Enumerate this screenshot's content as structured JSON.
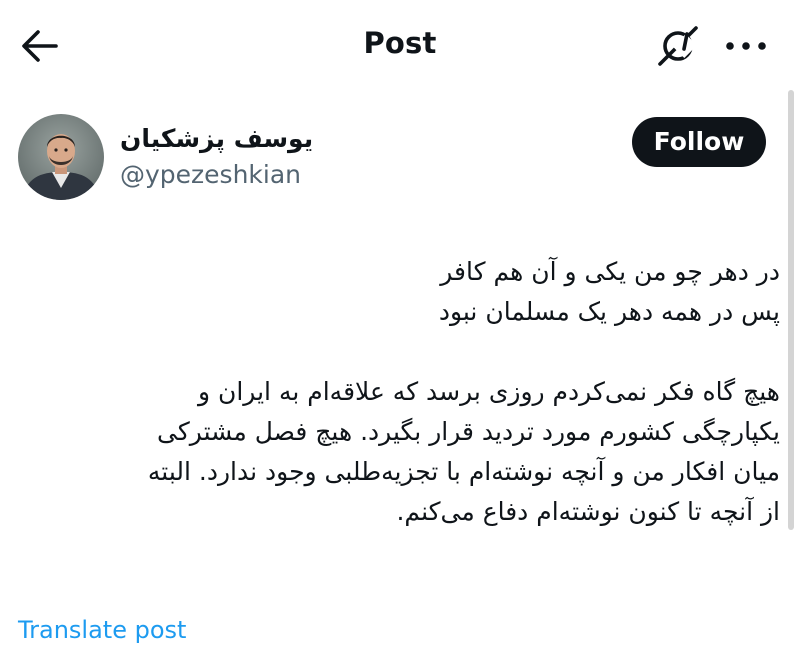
{
  "header": {
    "title": "Post",
    "back_icon": "arrow-left-icon",
    "grok_icon": "grok-icon",
    "more_icon": "more-horizontal-icon"
  },
  "author": {
    "name": "یوسف پزشکیان",
    "handle": "@ypezeshkian",
    "follow_label": "Follow"
  },
  "tweet": {
    "lines": [
      "در دهر چو من یکی و آن هم کافر",
      "پس در همه دهر یک مسلمان نبود",
      "",
      "هیچ گاه فکر نمی‌کردم روزی برسد که علاقه‌ام به ایران و",
      "یکپارچگی کشورم مورد تردید قرار بگیرد. هیچ فصل مشترکی",
      "میان افکار من و آنچه نوشته‌ام با تجزیه‌طلبی وجود ندارد. البته",
      "از آنچه تا کنون نوشته‌ام دفاع می‌کنم."
    ]
  },
  "footer": {
    "translate_label": "Translate post"
  },
  "colors": {
    "text": "#0f1419",
    "secondary": "#536471",
    "link": "#1d9bf0",
    "button_bg": "#0f1419",
    "button_text": "#ffffff"
  }
}
